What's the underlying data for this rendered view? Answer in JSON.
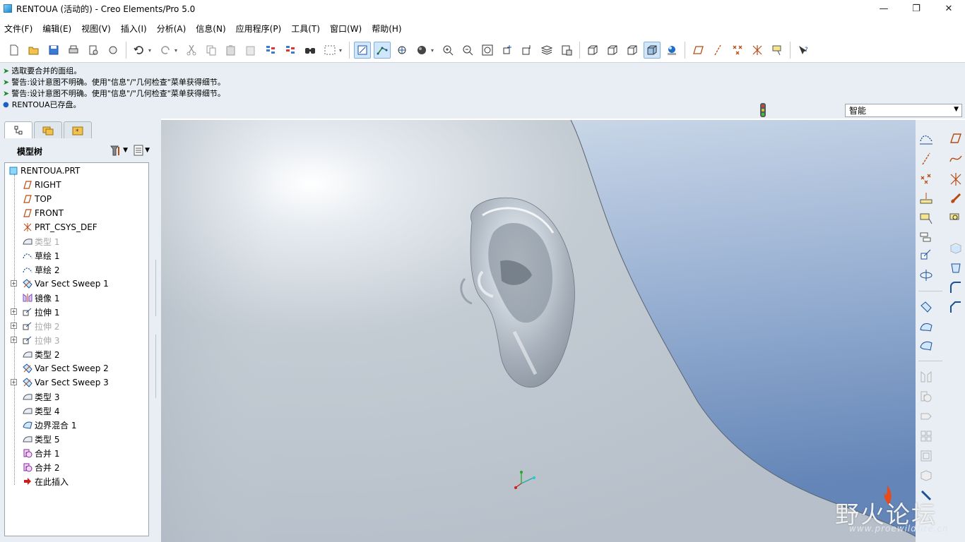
{
  "window": {
    "title": "RENTOUA (活动的) - Creo Elements/Pro 5.0",
    "controls": [
      "minimize-icon",
      "maximize-icon",
      "close-icon"
    ]
  },
  "menubar": {
    "items": [
      "文件(F)",
      "编辑(E)",
      "视图(V)",
      "插入(I)",
      "分析(A)",
      "信息(N)",
      "应用程序(P)",
      "工具(T)",
      "窗口(W)",
      "帮助(H)"
    ]
  },
  "toolbar": {
    "icons": [
      "new-icon",
      "open-icon",
      "save-icon",
      "print-icon",
      "send-mail-icon",
      "send-attachment-icon",
      "undo-icon",
      "redo-icon",
      "cut-icon",
      "copy-icon",
      "paste-icon",
      "paste-special-icon",
      "regenerate-icon",
      "regen-manager-icon",
      "find-icon",
      "select-box-icon",
      "datum-display-icon",
      "axis-display-icon",
      "csys-display-icon",
      "shading-icon",
      "zoom-in-icon",
      "zoom-out-icon",
      "refit-icon",
      "reorient-icon",
      "saved-views-icon",
      "layers-icon",
      "view-manager-icon",
      "wireframe-icon",
      "hidden-line-icon",
      "no-hidden-icon",
      "shaded-icon",
      "enhanced-realism-icon",
      "plane-display-icon",
      "axis-toggle-icon",
      "point-display-icon",
      "csys-toggle-icon",
      "annotation-display-icon",
      "context-help-icon"
    ],
    "active": [
      "datum-display-icon",
      "axis-display-icon",
      "shaded-icon"
    ]
  },
  "messages": [
    {
      "type": "prompt",
      "text": "选取要合并的面组。"
    },
    {
      "type": "warning",
      "text": "警告:设计意图不明确。使用\"信息\"/\"几何检查\"菜单获得细节。"
    },
    {
      "type": "warning",
      "text": "警告:设计意图不明确。使用\"信息\"/\"几何检查\"菜单获得细节。"
    },
    {
      "type": "info",
      "text": "RENTOUA已存盘。"
    }
  ],
  "filter": {
    "value": "智能"
  },
  "navigator": {
    "tabs": [
      "model-tree-tab-icon",
      "folder-browser-tab-icon",
      "favorites-tab-icon"
    ],
    "title": "模型树",
    "tools": [
      "settings-icon",
      "show-icon"
    ]
  },
  "model_tree": {
    "root": "RENTOUA.PRT",
    "items": [
      {
        "label": "RIGHT",
        "icon": "datum-plane-icon",
        "dim": false,
        "expandable": false
      },
      {
        "label": "TOP",
        "icon": "datum-plane-icon",
        "dim": false,
        "expandable": false
      },
      {
        "label": "FRONT",
        "icon": "datum-plane-icon",
        "dim": false,
        "expandable": false
      },
      {
        "label": "PRT_CSYS_DEF",
        "icon": "csys-icon",
        "dim": false,
        "expandable": false
      },
      {
        "label": "类型 1",
        "icon": "surface-icon",
        "dim": true,
        "expandable": false
      },
      {
        "label": "草绘 1",
        "icon": "sketch-icon",
        "dim": false,
        "expandable": false
      },
      {
        "label": "草绘 2",
        "icon": "sketch-icon",
        "dim": false,
        "expandable": false
      },
      {
        "label": "Var Sect Sweep 1",
        "icon": "sweep-icon",
        "dim": false,
        "expandable": true
      },
      {
        "label": "镜像 1",
        "icon": "mirror-icon",
        "dim": false,
        "expandable": false
      },
      {
        "label": "拉伸 1",
        "icon": "extrude-icon",
        "dim": false,
        "expandable": true
      },
      {
        "label": "拉伸 2",
        "icon": "extrude-icon",
        "dim": true,
        "expandable": true
      },
      {
        "label": "拉伸 3",
        "icon": "extrude-icon",
        "dim": true,
        "expandable": true
      },
      {
        "label": "类型 2",
        "icon": "surface-icon",
        "dim": false,
        "expandable": false
      },
      {
        "label": "Var Sect Sweep 2",
        "icon": "sweep-icon",
        "dim": false,
        "expandable": false
      },
      {
        "label": "Var Sect Sweep 3",
        "icon": "sweep-icon",
        "dim": false,
        "expandable": true
      },
      {
        "label": "类型 3",
        "icon": "surface-icon",
        "dim": false,
        "expandable": false
      },
      {
        "label": "类型 4",
        "icon": "surface-icon",
        "dim": false,
        "expandable": false
      },
      {
        "label": "边界混合 1",
        "icon": "boundary-blend-icon",
        "dim": false,
        "expandable": false
      },
      {
        "label": "类型 5",
        "icon": "surface-icon",
        "dim": false,
        "expandable": false
      },
      {
        "label": "合并 1",
        "icon": "merge-icon",
        "dim": false,
        "expandable": false
      },
      {
        "label": "合并 2",
        "icon": "merge-icon",
        "dim": false,
        "expandable": false
      },
      {
        "label": "在此插入",
        "icon": "insert-here-icon",
        "dim": false,
        "expandable": false
      }
    ]
  },
  "right_toolbar": {
    "icons": [
      "sketch-tool-icon",
      "plane-tool-icon",
      "axis-tool-icon",
      "curve-tool-icon",
      "point-tool-icon",
      "csys-tool-icon",
      "analysis-tool-icon",
      "publish-geom-icon",
      "annotation-icon",
      "view-annotation-icon",
      "note-icon",
      "extrude-tool-icon",
      "revolve-tool-icon",
      "sweep-tool-icon",
      "blend-tool-icon",
      "boundary-tool-icon",
      "mirror-tool-icon",
      "merge-tool-icon",
      "trim-tool-icon",
      "pattern-tool-icon",
      "shell-tool-icon",
      "rib-tool-icon",
      "hole-tool-icon",
      "draft-tool-icon",
      "round-tool-icon",
      "chamfer-tool-icon",
      "edit-tool-icon"
    ]
  },
  "watermark": {
    "cn": "野火论坛",
    "url": "www.proewildfire.cn"
  },
  "colors": {
    "bg_panel": "#e8eef3",
    "viewport_bg_top": "#c8d6e6",
    "viewport_bg_bottom": "#6f8fbf",
    "surface": "#c4ccd4",
    "plane_icon": "#b84a10"
  }
}
